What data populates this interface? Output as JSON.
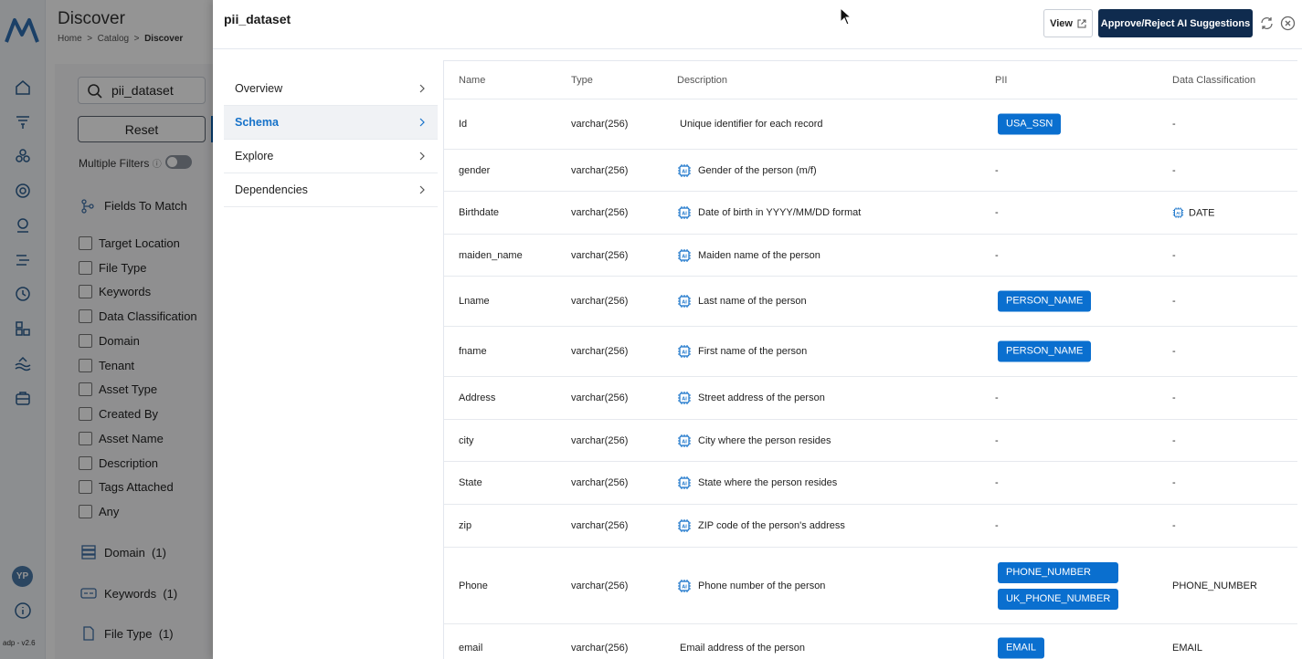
{
  "app": {
    "version": "adp - v2.6",
    "user_initials": "YP"
  },
  "discover": {
    "title": "Discover",
    "breadcrumb": [
      "Home",
      "Catalog",
      "Discover"
    ],
    "search_value": "pii_dataset",
    "reset_label": "Reset",
    "multiple_filters_label": "Multiple Filters",
    "fields_to_match_label": "Fields To Match",
    "fields": [
      "Target Location",
      "File Type",
      "Keywords",
      "Data Classification",
      "Domain",
      "Tenant",
      "Asset Type",
      "Created By",
      "Asset Name",
      "Description",
      "Tags Attached",
      "Any"
    ],
    "facets": [
      {
        "label": "Domain",
        "count": "(1)",
        "icon": "domain-icon"
      },
      {
        "label": "Keywords",
        "count": "(1)",
        "icon": "keywords-icon"
      },
      {
        "label": "File Type",
        "count": "(1)",
        "icon": "file-icon"
      }
    ]
  },
  "drawer": {
    "title": "pii_dataset",
    "view_label": "View",
    "approve_label": "Approve/Reject AI Suggestions",
    "nav": [
      {
        "label": "Overview",
        "active": false
      },
      {
        "label": "Schema",
        "active": true
      },
      {
        "label": "Explore",
        "active": false
      },
      {
        "label": "Dependencies",
        "active": false
      }
    ],
    "columns": [
      "Name",
      "Type",
      "Description",
      "PII",
      "Data Classification"
    ],
    "rows": [
      {
        "name": "Id",
        "type": "varchar(256)",
        "description": "Unique identifier for each record",
        "ai": false,
        "pii": [
          "USA_SSN"
        ],
        "classification": "-",
        "class_ai": false
      },
      {
        "name": "gender",
        "type": "varchar(256)",
        "description": "Gender of the person (m/f)",
        "ai": true,
        "pii": [
          "-"
        ],
        "classification": "-",
        "class_ai": false
      },
      {
        "name": "Birthdate",
        "type": "varchar(256)",
        "description": "Date of birth in YYYY/MM/DD format",
        "ai": true,
        "pii": [
          "-"
        ],
        "classification": "DATE",
        "class_ai": true
      },
      {
        "name": "maiden_name",
        "type": "varchar(256)",
        "description": "Maiden name of the person",
        "ai": true,
        "pii": [
          "-"
        ],
        "classification": "-",
        "class_ai": false
      },
      {
        "name": "Lname",
        "type": "varchar(256)",
        "description": "Last name of the person",
        "ai": true,
        "pii": [
          "PERSON_NAME"
        ],
        "classification": "-",
        "class_ai": false
      },
      {
        "name": "fname",
        "type": "varchar(256)",
        "description": "First name of the person",
        "ai": true,
        "pii": [
          "PERSON_NAME"
        ],
        "classification": "-",
        "class_ai": false
      },
      {
        "name": "Address",
        "type": "varchar(256)",
        "description": "Street address of the person",
        "ai": true,
        "pii": [
          "-"
        ],
        "classification": "-",
        "class_ai": false
      },
      {
        "name": "city",
        "type": "varchar(256)",
        "description": "City where the person resides",
        "ai": true,
        "pii": [
          "-"
        ],
        "classification": "-",
        "class_ai": false
      },
      {
        "name": "State",
        "type": "varchar(256)",
        "description": "State where the person resides",
        "ai": true,
        "pii": [
          "-"
        ],
        "classification": "-",
        "class_ai": false
      },
      {
        "name": "zip",
        "type": "varchar(256)",
        "description": "ZIP code of the person's address",
        "ai": true,
        "pii": [
          "-"
        ],
        "classification": "-",
        "class_ai": false
      },
      {
        "name": "Phone",
        "type": "varchar(256)",
        "description": "Phone number of the person",
        "ai": true,
        "pii": [
          "PHONE_NUMBER",
          "UK_PHONE_NUMBER"
        ],
        "classification": "PHONE_NUMBER",
        "class_ai": false
      },
      {
        "name": "email",
        "type": "varchar(256)",
        "description": "Email address of the person",
        "ai": false,
        "pii": [
          "EMAIL"
        ],
        "classification": "EMAIL",
        "class_ai": false
      }
    ]
  },
  "colors": {
    "accent": "#1672c9",
    "tag": "#0a6fcf",
    "primary_button": "#0f2b4e"
  }
}
